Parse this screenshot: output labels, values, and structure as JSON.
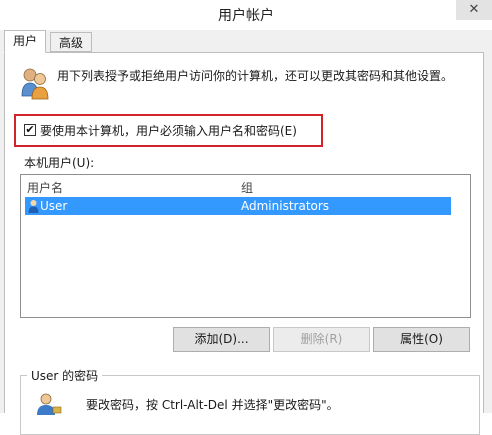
{
  "window": {
    "title": "用户帐户",
    "close_glyph": "✕"
  },
  "tabs": [
    {
      "label": "用户",
      "active": true
    },
    {
      "label": "高级",
      "active": false
    }
  ],
  "description": "用下列表授予或拒绝用户访问你的计算机，还可以更改其密码和其他设置。",
  "require_login": {
    "label": "要使用本计算机，用户必须输入用户名和密码(E)",
    "checked": true,
    "check_glyph": "✔"
  },
  "local_users": {
    "label": "本机用户(U):",
    "columns": [
      "用户名",
      "组"
    ],
    "rows": [
      {
        "name": "User",
        "group": "Administrators",
        "selected": true
      }
    ]
  },
  "buttons": {
    "add": "添加(D)...",
    "remove": "删除(R)",
    "properties": "属性(O)"
  },
  "password_section": {
    "title": "User 的密码",
    "text": "要改密码，按 Ctrl-Alt-Del 并选择\"更改密码\"。"
  },
  "colors": {
    "highlight_border": "#d2232a",
    "selection": "#3399ff"
  }
}
